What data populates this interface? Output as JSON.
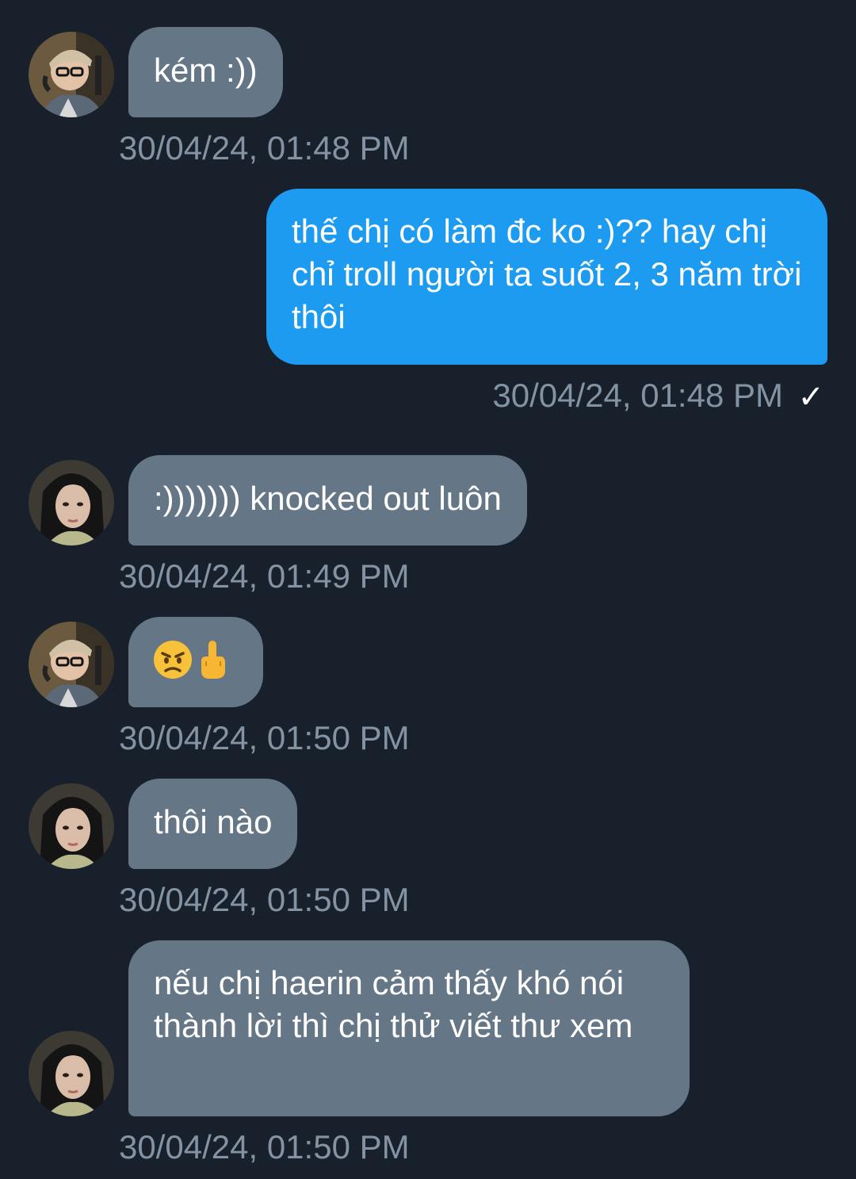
{
  "messages": [
    {
      "text": "kém :))",
      "timestamp": "30/04/24, 01:48 PM"
    },
    {
      "text": "thế chị có làm đc ko :)?? hay chị chỉ troll người ta suốt 2, 3 năm trời thôi",
      "timestamp": "30/04/24, 01:48 PM",
      "status_icon": "check-icon"
    },
    {
      "text": ":))))))) knocked out luôn",
      "timestamp": "30/04/24, 01:49 PM"
    },
    {
      "emojis": [
        "angry-face-emoji",
        "middle-finger-emoji"
      ],
      "timestamp": "30/04/24, 01:50 PM"
    },
    {
      "text": "thôi nào",
      "timestamp": "30/04/24, 01:50 PM"
    },
    {
      "text": "nếu chị haerin cảm thấy khó nói thành lời thì chị thử viết thư xem",
      "timestamp": "30/04/24, 01:50 PM"
    }
  ],
  "colors": {
    "background": "#17202b",
    "incoming_bubble": "#657687",
    "outgoing_bubble": "#1d9bf0",
    "timestamp": "#8493a3"
  }
}
